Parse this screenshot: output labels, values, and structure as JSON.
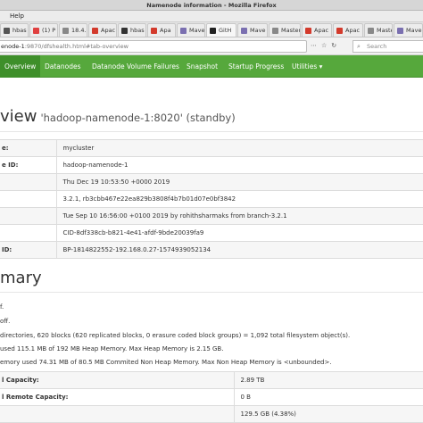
{
  "window": {
    "title": "Namenode information - Mozilla Firefox"
  },
  "menubar": {
    "help": "Help"
  },
  "tabs": [
    {
      "label": "hbas",
      "color": "#555555"
    },
    {
      "label": "(1) P",
      "color": "#e04040"
    },
    {
      "label": "18.4. Bu",
      "color": "#888888"
    },
    {
      "label": "Apac",
      "color": "#d33a2c"
    },
    {
      "label": "hbas",
      "color": "#333333"
    },
    {
      "label": "Apa",
      "color": "#d33a2c"
    },
    {
      "label": "Mave",
      "color": "#7a6fb0"
    },
    {
      "label": "GitH",
      "color": "#222222"
    },
    {
      "label": "Mave",
      "color": "#7a6fb0"
    },
    {
      "label": "Master",
      "color": "#888888"
    },
    {
      "label": "Apac",
      "color": "#d33a2c"
    },
    {
      "label": "Apac",
      "color": "#d33a2c"
    },
    {
      "label": "Maste",
      "color": "#888888"
    },
    {
      "label": "Mave",
      "color": "#7a6fb0"
    }
  ],
  "address": {
    "host": "enode-1",
    "path": ":9870/dfshealth.html#tab-overview"
  },
  "search": {
    "placeholder": "Search"
  },
  "hadoop_nav": [
    {
      "label": "Overview",
      "active": true
    },
    {
      "label": "Datanodes"
    },
    {
      "label": "Datanode Volume Failures"
    },
    {
      "label": "Snapshot"
    },
    {
      "label": "Startup Progress"
    },
    {
      "label": "Utilities ▾"
    }
  ],
  "overview": {
    "heading": "view",
    "sub": "'hadoop-namenode-1:8020' (standby)",
    "rows": [
      {
        "key": "e:",
        "value": "mycluster"
      },
      {
        "key": "e ID:",
        "value": "hadoop-namenode-1"
      },
      {
        "key": "",
        "value": "Thu Dec 19 10:53:50 +0000 2019"
      },
      {
        "key": "",
        "value": "3.2.1, rb3cbb467e22ea829b3808f4b7b01d07e0bf3842"
      },
      {
        "key": "",
        "value": "Tue Sep 10 16:56:00 +0100 2019 by rohithsharmaks from branch-3.2.1"
      },
      {
        "key": "",
        "value": "CID-8df338cb-b821-4e41-afdf-9bde20039fa9"
      },
      {
        "key": "ID:",
        "value": "BP-1814822552-192.168.0.27-1574939052134"
      }
    ]
  },
  "summary": {
    "heading": "mary",
    "lines": [
      "f.",
      "off.",
      "directories, 620 blocks (620 replicated blocks, 0 erasure coded block groups) = 1,092 total filesystem object(s).",
      "used 115.1 MB of 192 MB Heap Memory. Max Heap Memory is 2.15 GB.",
      "emory used 74.31 MB of 80.5 MB Commited Non Heap Memory. Max Non Heap Memory is <unbounded>."
    ],
    "rows": [
      {
        "key": "l Capacity:",
        "value": "2.89 TB"
      },
      {
        "key": "l Remote Capacity:",
        "value": "0 B"
      },
      {
        "key": "",
        "value": "129.5 GB (4.38%)"
      }
    ]
  }
}
